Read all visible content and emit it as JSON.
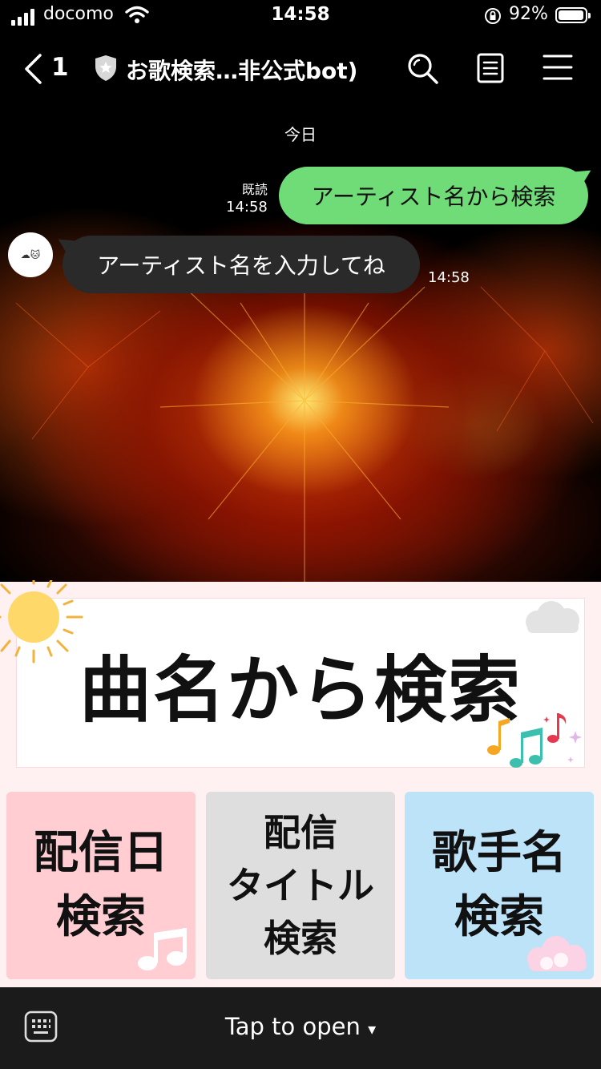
{
  "status_bar": {
    "carrier": "docomo",
    "time": "14:58",
    "battery_percent": "92%",
    "battery_level": 0.92,
    "icons": [
      "signal-icon",
      "wifi-icon",
      "rotation-lock-icon",
      "battery-icon"
    ]
  },
  "nav": {
    "unread_count": "1",
    "title": "お歌検索…非公式bot)",
    "icons": [
      "back-chevron-icon",
      "shield-star-icon",
      "search-icon",
      "notes-icon",
      "menu-icon"
    ]
  },
  "chat": {
    "date_divider": "今日",
    "messages": [
      {
        "from": "me",
        "text": "アーティスト名から検索",
        "read_label": "既読",
        "time": "14:58"
      },
      {
        "from": "bot",
        "text": "アーティスト名を入力してね",
        "time": "14:58",
        "avatar_text": "☁🐱"
      }
    ]
  },
  "rich_menu": {
    "song_search": "曲名から検索",
    "tiles": [
      {
        "lines": [
          "配信日",
          "検索"
        ],
        "color": "#ffcdd2"
      },
      {
        "lines": [
          "配信",
          "タイトル",
          "検索"
        ],
        "color": "#dedede"
      },
      {
        "lines": [
          "歌手名",
          "検索"
        ],
        "color": "#bde3f8"
      }
    ]
  },
  "bottom_bar": {
    "label": "Tap to open",
    "arrow": "▾"
  },
  "colors": {
    "sent_bubble": "#6fdc77",
    "received_bubble": "#2a2a2a",
    "menu_bg": "#fff1f1"
  }
}
